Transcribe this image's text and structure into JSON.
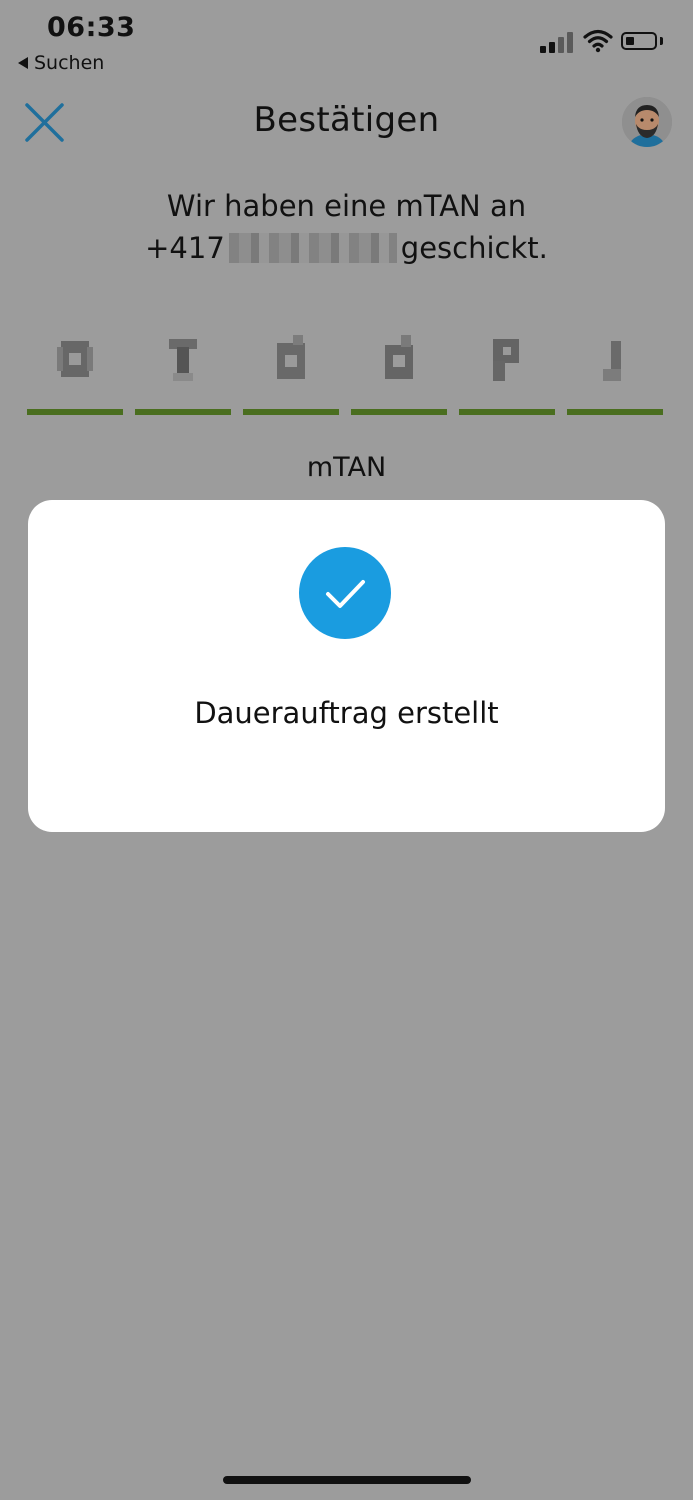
{
  "status_bar": {
    "time": "06:33",
    "back_app": "Suchen",
    "signal_icon": "cellular-signal-icon",
    "wifi_icon": "wifi-icon",
    "battery_icon": "battery-icon",
    "battery_level": 0.3
  },
  "header": {
    "title": "Bestätigen",
    "close_icon": "close-icon",
    "avatar_icon": "user-avatar"
  },
  "message": {
    "line1": "Wir haben eine mTAN an",
    "phone_prefix": "+417",
    "line2_suffix": "geschickt."
  },
  "code": {
    "digits_count": 6,
    "underline_color": "#4a6e1f"
  },
  "mtan_label": "mTAN",
  "modal": {
    "icon": "checkmark-icon",
    "icon_color": "#1a9ce0",
    "text": "Dauerauftrag erstellt"
  }
}
